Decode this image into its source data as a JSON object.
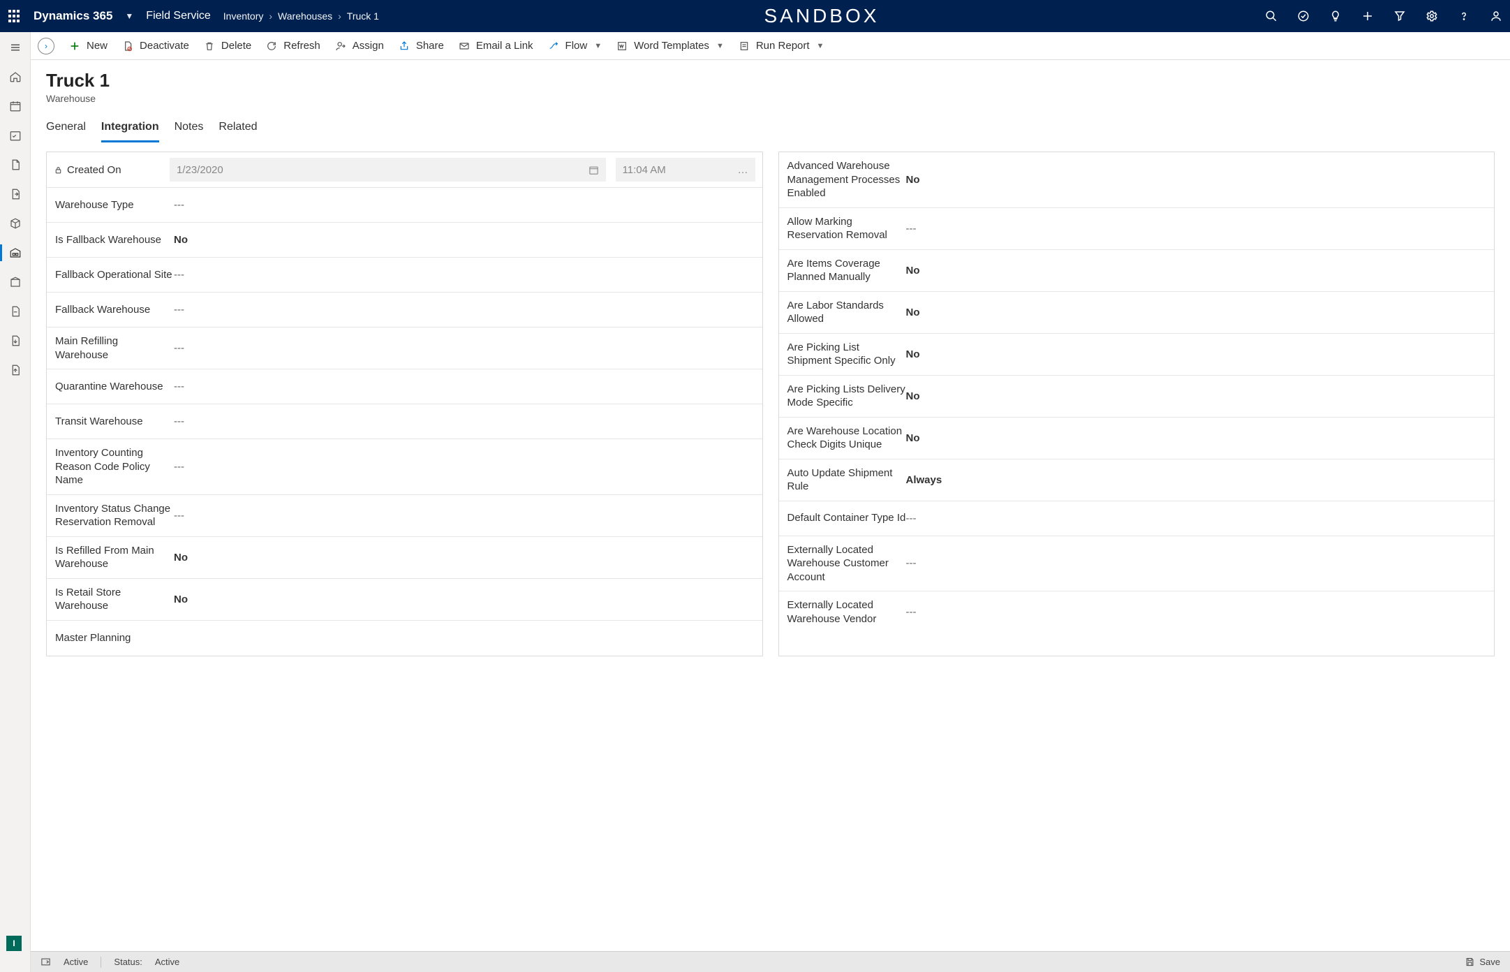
{
  "top": {
    "brand": "Dynamics 365",
    "app": "Field Service",
    "crumbs": [
      "Inventory",
      "Warehouses",
      "Truck 1"
    ],
    "centerWord": "SANDBOX"
  },
  "cmd": {
    "new": "New",
    "deactivate": "Deactivate",
    "delete": "Delete",
    "refresh": "Refresh",
    "assign": "Assign",
    "share": "Share",
    "emailLink": "Email a Link",
    "flow": "Flow",
    "wordTemplates": "Word Templates",
    "runReport": "Run Report"
  },
  "page": {
    "title": "Truck 1",
    "subtitle": "Warehouse"
  },
  "tabs": {
    "general": "General",
    "integration": "Integration",
    "notes": "Notes",
    "related": "Related"
  },
  "lockField": {
    "label": "Created On",
    "date": "1/23/2020",
    "time": "11:04 AM"
  },
  "left": [
    {
      "label": "Warehouse Type",
      "value": "---"
    },
    {
      "label": "Is Fallback Warehouse",
      "value": "No",
      "bold": true
    },
    {
      "label": "Fallback Operational Site",
      "value": "---"
    },
    {
      "label": "Fallback Warehouse",
      "value": "---"
    },
    {
      "label": "Main Refilling Warehouse",
      "value": "---"
    },
    {
      "label": "Quarantine Warehouse",
      "value": "---"
    },
    {
      "label": "Transit Warehouse",
      "value": "---"
    },
    {
      "label": "Inventory Counting Reason Code Policy Name",
      "value": "---"
    },
    {
      "label": "Inventory Status Change Reservation Removal",
      "value": "---"
    },
    {
      "label": "Is Refilled From Main Warehouse",
      "value": "No",
      "bold": true
    },
    {
      "label": "Is Retail Store Warehouse",
      "value": "No",
      "bold": true
    },
    {
      "label": "Master Planning",
      "value": ""
    }
  ],
  "right": [
    {
      "label": "Advanced Warehouse Management Processes Enabled",
      "value": "No",
      "bold": true
    },
    {
      "label": "Allow Marking Reservation Removal",
      "value": "---"
    },
    {
      "label": "Are Items Coverage Planned Manually",
      "value": "No",
      "bold": true
    },
    {
      "label": "Are Labor Standards Allowed",
      "value": "No",
      "bold": true
    },
    {
      "label": "Are Picking List Shipment Specific Only",
      "value": "No",
      "bold": true
    },
    {
      "label": "Are Picking Lists Delivery Mode Specific",
      "value": "No",
      "bold": true
    },
    {
      "label": "Are Warehouse Location Check Digits Unique",
      "value": "No",
      "bold": true
    },
    {
      "label": "Auto Update Shipment Rule",
      "value": "Always",
      "bold": true
    },
    {
      "label": "Default Container Type Id",
      "value": "---"
    },
    {
      "label": "Externally Located Warehouse Customer Account",
      "value": "---"
    },
    {
      "label": "Externally Located Warehouse Vendor",
      "value": "---"
    }
  ],
  "footer": {
    "state": "Active",
    "statusLabel": "Status:",
    "statusValue": "Active",
    "save": "Save",
    "iBadge": "I"
  }
}
